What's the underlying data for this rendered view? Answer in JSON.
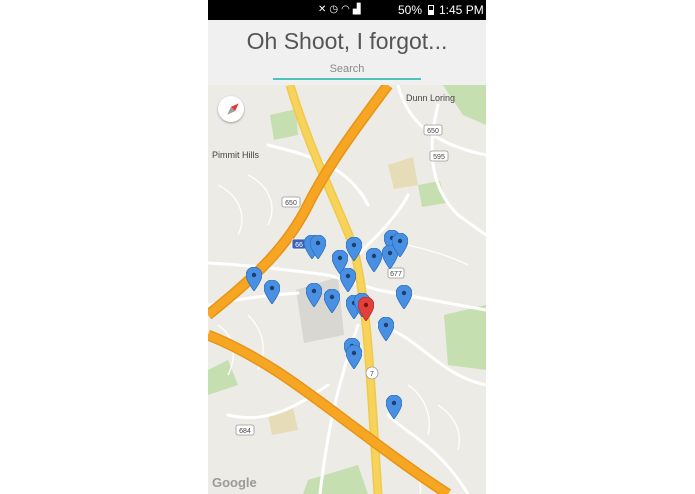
{
  "status_bar": {
    "battery": "50%",
    "time": "1:45 PM",
    "icons": [
      "mute-icon",
      "alarm-icon",
      "wifi-icon",
      "signal-icon",
      "battery-icon"
    ]
  },
  "header": {
    "title": "Oh Shoot, I forgot...",
    "search_placeholder": "Search",
    "search_value": ""
  },
  "map": {
    "labels": {
      "dunn_loring": "Dunn Loring",
      "pimmit_hills": "Pimmit Hills",
      "google": "Google"
    },
    "route_shields": [
      "650",
      "650",
      "595",
      "66",
      "677",
      "7",
      "684"
    ],
    "markers": {
      "blue_count": 20,
      "red_count": 1
    },
    "colors": {
      "blue_marker": "#4a90e2",
      "red_marker": "#e2403b",
      "highway": "#f6a623",
      "arterial": "#f8d35b",
      "land": "#ecebe6",
      "park": "#c6dfb0"
    }
  }
}
